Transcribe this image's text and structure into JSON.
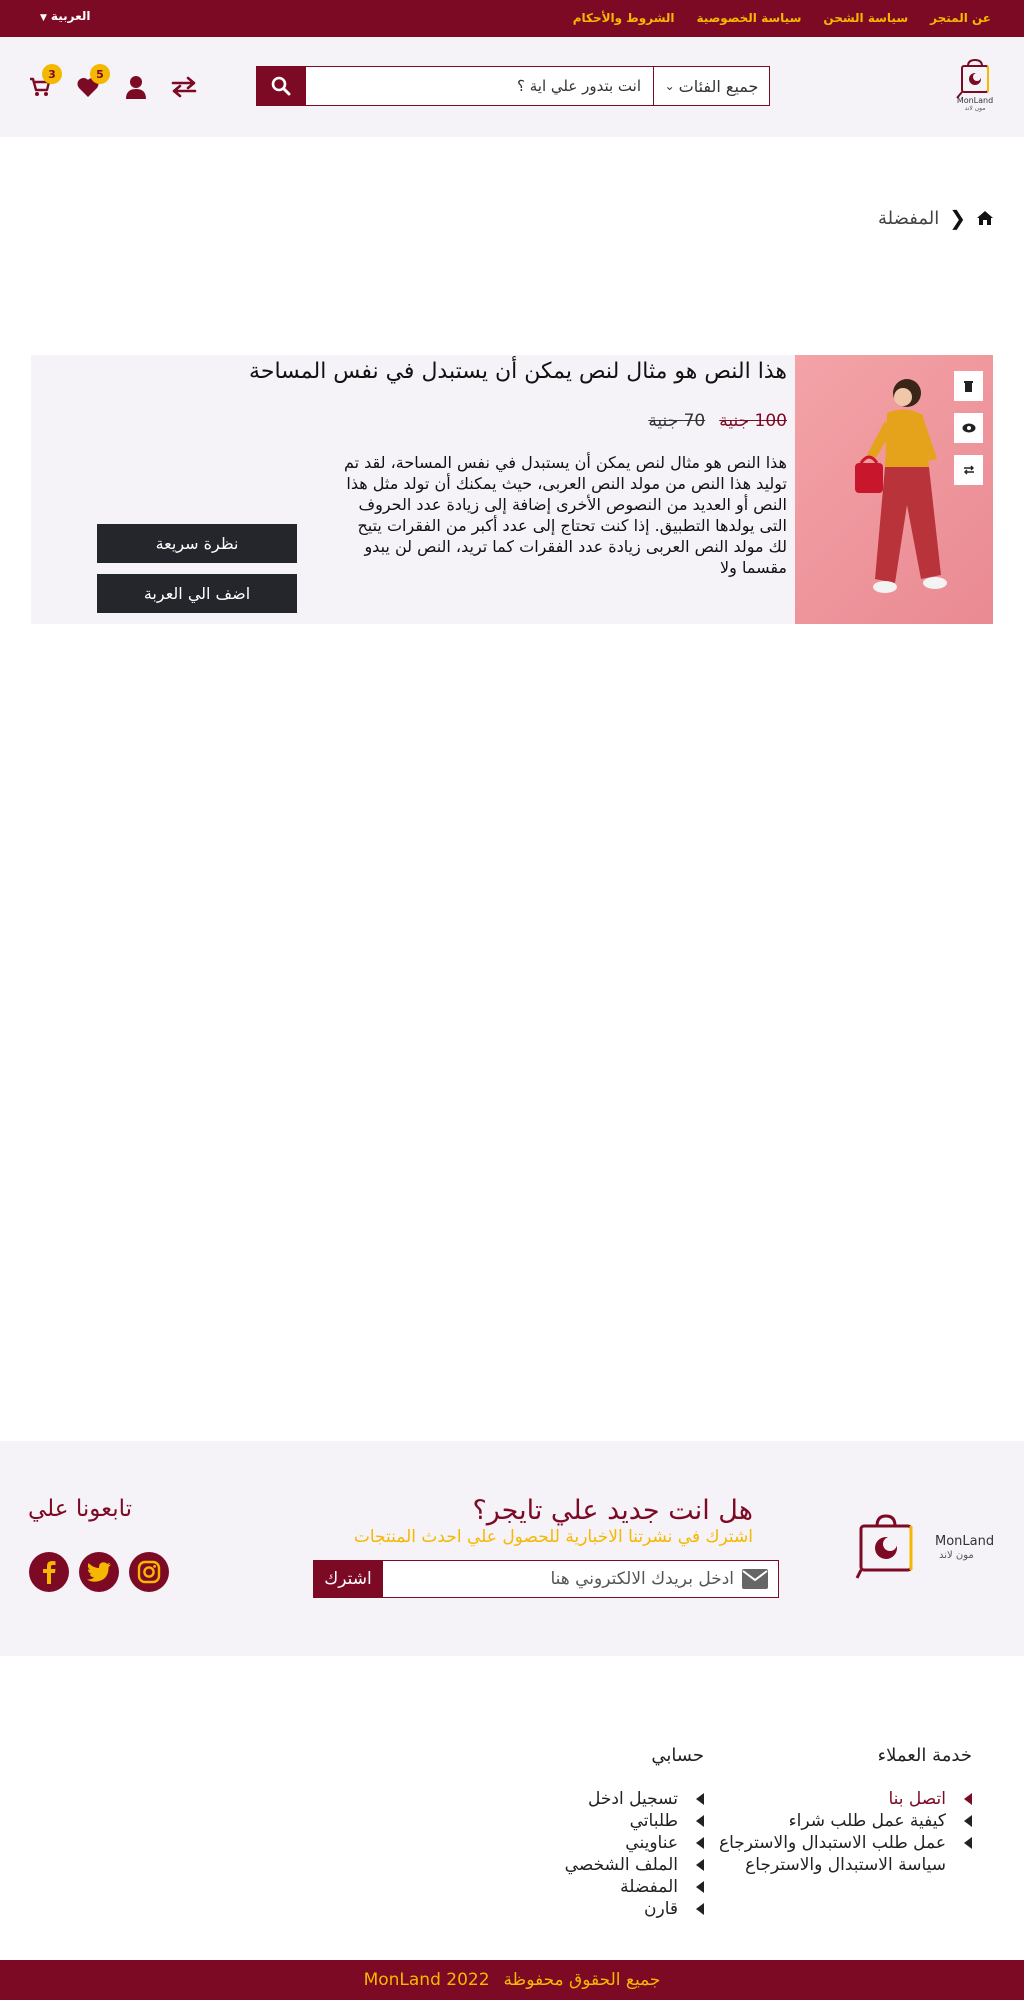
{
  "topbar": {
    "links": [
      "عن المتجر",
      "سياسة الشحن",
      "سياسة الخصوصية",
      "الشروط والأحكام"
    ],
    "language": "العربية"
  },
  "header": {
    "logo_text_en": "MonLand",
    "logo_text_ar": "مون لاند",
    "search": {
      "category_label": "جميع الفئات",
      "placeholder": "انت بتدور علي اية ؟"
    },
    "cart_count": "3",
    "wishlist_count": "5",
    "icons": [
      "cart-icon",
      "heart-icon",
      "user-icon",
      "compare-icon",
      "search-icon"
    ]
  },
  "breadcrumb": {
    "current": "المفضلة"
  },
  "product": {
    "title": "هذا النص هو مثال لنص يمكن أن يستبدل في نفس المساحة",
    "price_current": "100 جنية",
    "price_old": "70 جنية",
    "description": "هذا النص هو مثال لنص يمكن أن يستبدل في نفس المساحة، لقد تم توليد هذا النص من مولد النص العربى، حيث يمكنك أن تولد مثل هذا النص أو العديد من النصوص الأخرى إضافة إلى زيادة عدد الحروف التى يولدها التطبيق. إذا كنت تحتاج إلى عدد أكبر من الفقرات يتيح لك مولد النص العربى زيادة عدد الفقرات كما تريد، النص لن يبدو مقسما ولا",
    "quick_view_label": "نظرة سريعة",
    "add_to_cart_label": "اضف الي العربة"
  },
  "newsletter": {
    "title": "هل انت جديد علي تايجر؟",
    "subtitle": "اشترك في نشرتنا الاخبارية للحصول علي احدث المنتجات",
    "placeholder": "ادخل بريدك الالكتروني هنا",
    "button_label": "اشترك",
    "follow_title": "تابعونا علي"
  },
  "footer": {
    "customer_service": {
      "title": "خدمة العملاء",
      "items": [
        "اتصل بنا",
        "كيفية عمل طلب شراء",
        "عمل طلب الاستبدال والاسترجاع",
        "سياسة الاستبدال والاسترجاع"
      ]
    },
    "account": {
      "title": "حسابي",
      "items": [
        "تسجيل  ادخل",
        "طلباتي",
        "عناويني",
        "الملف الشخصي",
        "المفضلة",
        "قارن"
      ]
    },
    "copyright": "جميع الحقوق محفوظة",
    "copyright_brand": "MonLand 2022"
  },
  "colors": {
    "primary": "#7d0a24",
    "accent": "#f5b800",
    "dark_button": "#24262c",
    "light_bg": "#f6f3f8"
  }
}
